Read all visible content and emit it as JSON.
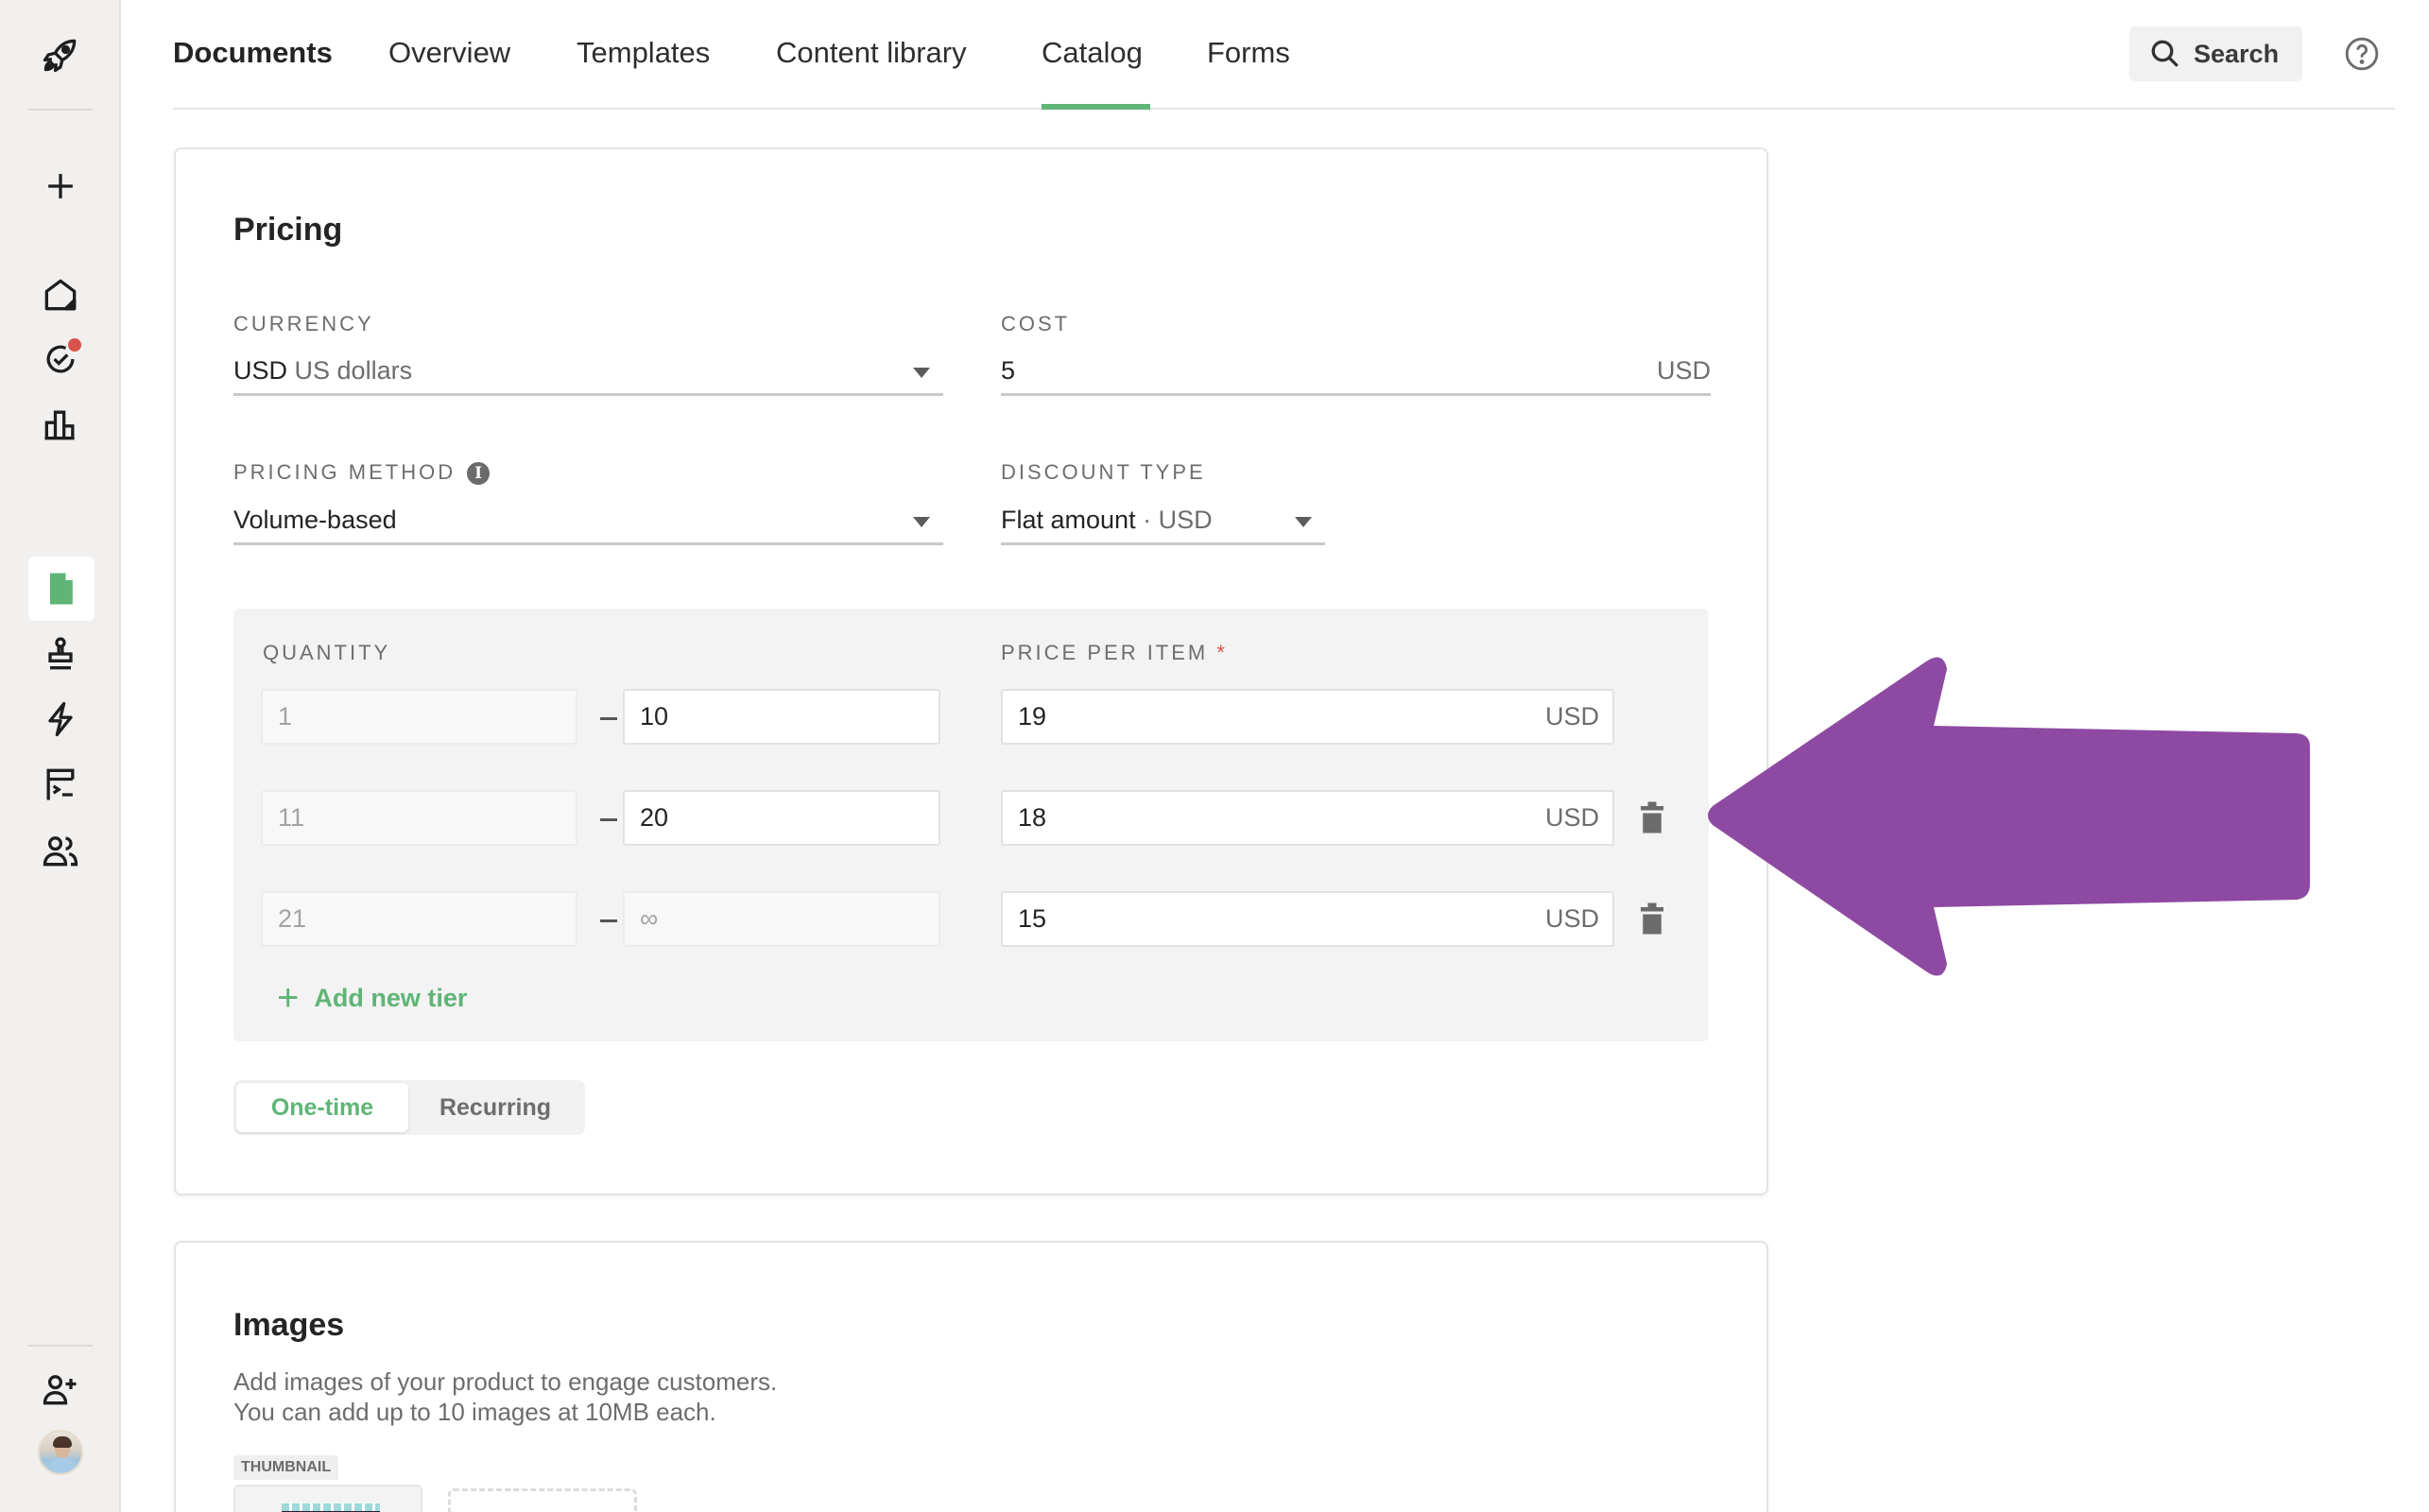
{
  "nav": {
    "items": [
      {
        "label": "Documents",
        "brand": true
      },
      {
        "label": "Overview"
      },
      {
        "label": "Templates"
      },
      {
        "label": "Content library"
      },
      {
        "label": "Catalog",
        "active": true
      },
      {
        "label": "Forms"
      }
    ],
    "search_label": "Search",
    "accent_color": "#5fb576"
  },
  "sidebar": {
    "icons": [
      "rocket-logo",
      "plus",
      "home",
      "tasks",
      "reports",
      "documents",
      "stamp",
      "automation",
      "forms",
      "contacts",
      "invite-user",
      "avatar"
    ],
    "active": "documents",
    "notification_color": "#d9534a"
  },
  "pricing": {
    "title": "Pricing",
    "currency": {
      "label": "CURRENCY",
      "code": "USD",
      "name": "US dollars"
    },
    "cost": {
      "label": "COST",
      "value": "5",
      "suffix": "USD"
    },
    "pricing_method": {
      "label": "PRICING METHOD",
      "value": "Volume-based",
      "info": "i"
    },
    "discount_type": {
      "label": "DISCOUNT TYPE",
      "value": "Flat amount",
      "suffix": "· USD"
    },
    "tiers": {
      "quantity_label": "QUANTITY",
      "price_label": "PRICE PER ITEM",
      "required_mark": "*",
      "rows": [
        {
          "from": "1",
          "to": "10",
          "to_editable": true,
          "price": "19",
          "currency": "USD",
          "deletable": false
        },
        {
          "from": "11",
          "to": "20",
          "to_editable": true,
          "price": "18",
          "currency": "USD",
          "deletable": true
        },
        {
          "from": "21",
          "to": "∞",
          "to_editable": false,
          "price": "15",
          "currency": "USD",
          "deletable": true
        }
      ],
      "add_label": "Add new tier"
    },
    "billing": {
      "options": [
        "One-time",
        "Recurring"
      ],
      "selected": "One-time"
    }
  },
  "images": {
    "title": "Images",
    "desc_line1": "Add images of your product to engage customers.",
    "desc_line2": "You can add up to 10 images at 10MB each.",
    "thumbnail_label": "THUMBNAIL"
  },
  "annotation": {
    "type": "arrow",
    "direction": "left",
    "color": "#8e4aa3",
    "points_to": "tier-2-delete-button"
  }
}
